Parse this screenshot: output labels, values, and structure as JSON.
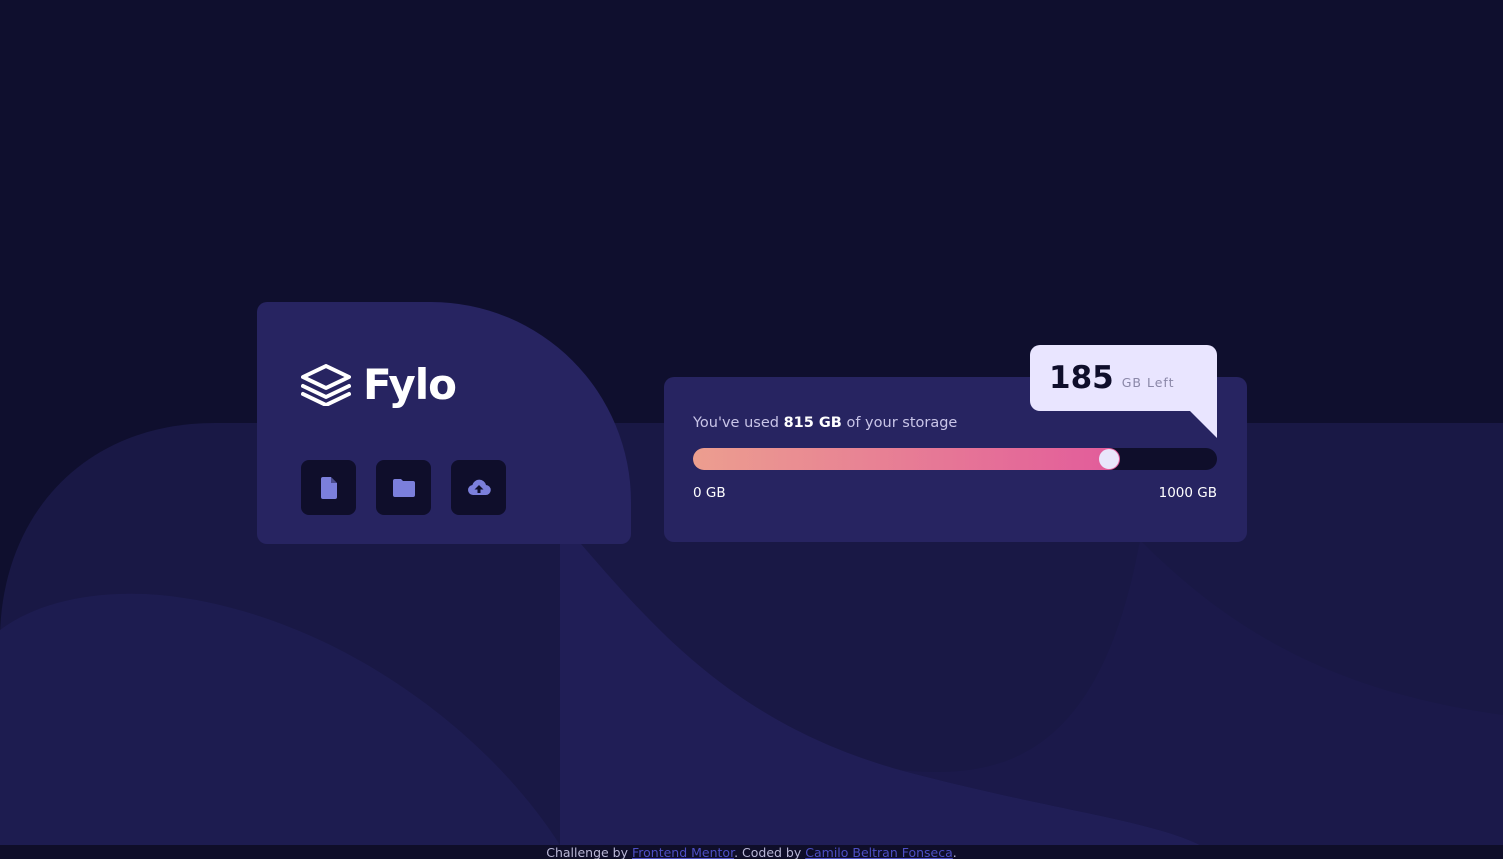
{
  "brand": {
    "name": "Fylo"
  },
  "toolbar": {
    "buttons": [
      {
        "icon": "document-icon"
      },
      {
        "icon": "folder-icon"
      },
      {
        "icon": "cloud-upload-icon"
      }
    ]
  },
  "storage": {
    "used_prefix": "You've used ",
    "used_amount": "815 GB",
    "used_suffix": " of your storage",
    "used_gb": 815,
    "total_gb": 1000,
    "fill_fraction": 0.815,
    "scale_min": "0 GB",
    "scale_max": "1000 GB"
  },
  "callout": {
    "remaining": "185",
    "unit": "GB Left"
  },
  "footer": {
    "prefix": "Challenge by ",
    "link1": "Frontend Mentor",
    "middle": ". Coded by ",
    "link2": "Camilo Beltran Fonseca",
    "suffix": "."
  },
  "colors": {
    "page_bg": "#0f0f2e",
    "card_bg": "#272461",
    "button_bg": "#0f0e2b",
    "icon": "#7b7fdc",
    "gradient_start": "#ec9e8f",
    "gradient_end": "#e25b9b",
    "callout_bg": "#e9e5ff",
    "link": "#4d4fc4"
  }
}
